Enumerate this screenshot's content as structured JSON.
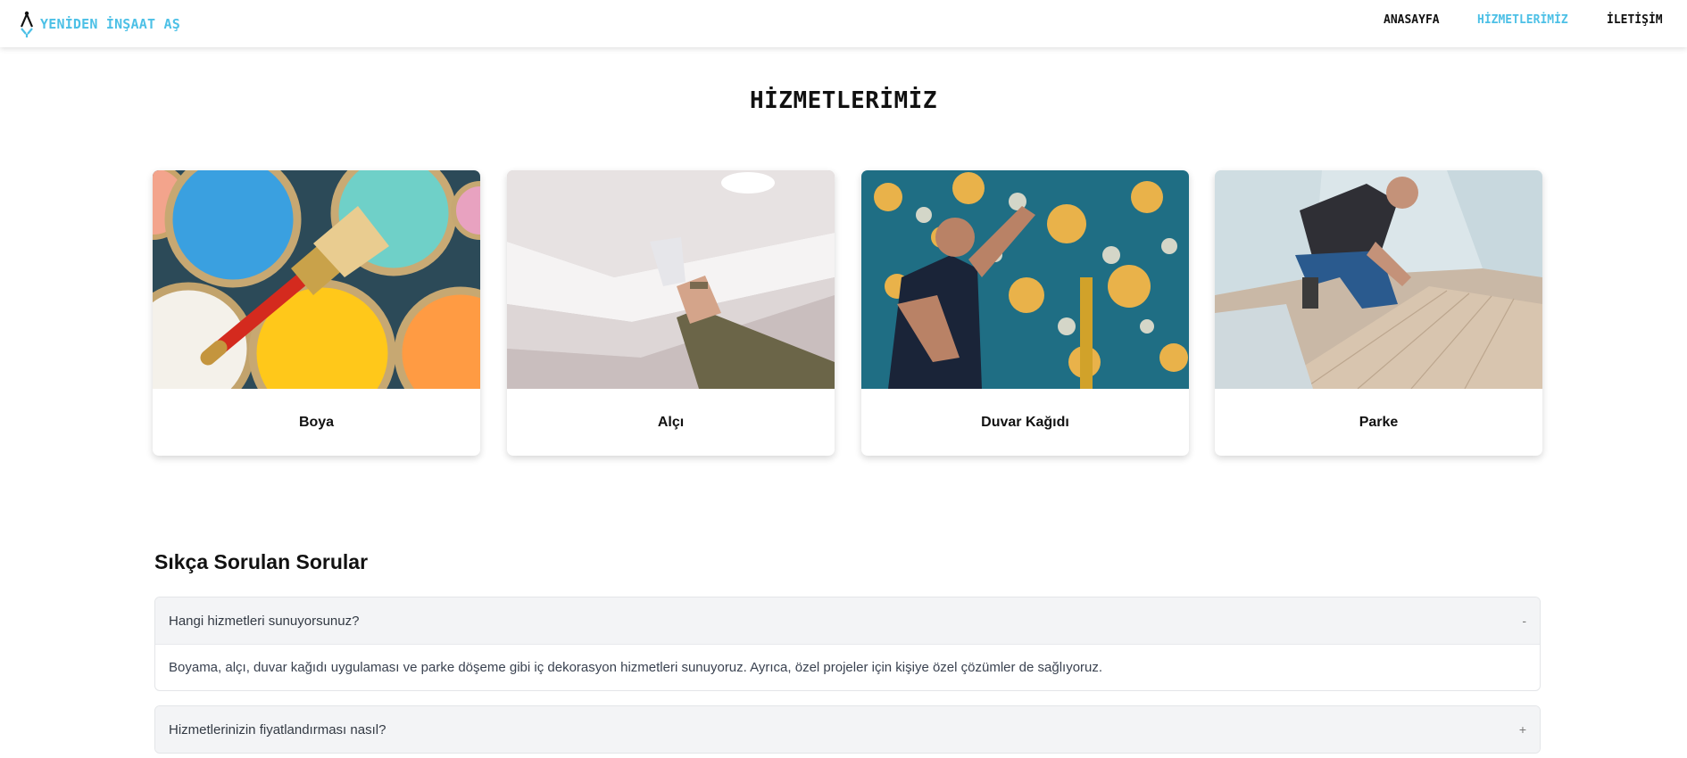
{
  "brand": {
    "name": "YENİDEN İNŞAAT AŞ",
    "icon": "compass-icon",
    "color": "#4cc0e6"
  },
  "nav": {
    "items": [
      {
        "label": "ANASAYFA",
        "active": false
      },
      {
        "label": "HİZMETLERİMİZ",
        "active": true
      },
      {
        "label": "İLETİŞİM",
        "active": false
      }
    ]
  },
  "page": {
    "title": "HİZMETLERİMİZ"
  },
  "services": [
    {
      "label": "Boya",
      "image": "paint-cans-photo"
    },
    {
      "label": "Alçı",
      "image": "plaster-ceiling-photo"
    },
    {
      "label": "Duvar Kağıdı",
      "image": "wallpaper-hanging-photo"
    },
    {
      "label": "Parke",
      "image": "parquet-flooring-photo"
    }
  ],
  "faq": {
    "heading": "Sıkça Sorulan Sorular",
    "items": [
      {
        "question": "Hangi hizmetleri sunuyorsunuz?",
        "toggle": "-",
        "expanded": true,
        "answer": "Boyama, alçı, duvar kağıdı uygulaması ve parke döşeme gibi iç dekorasyon hizmetleri sunuyoruz. Ayrıca, özel projeler için kişiye özel çözümler de sağlıyoruz."
      },
      {
        "question": "Hizmetlerinizin fiyatlandırması nasıl?",
        "toggle": "+",
        "expanded": false
      }
    ]
  }
}
